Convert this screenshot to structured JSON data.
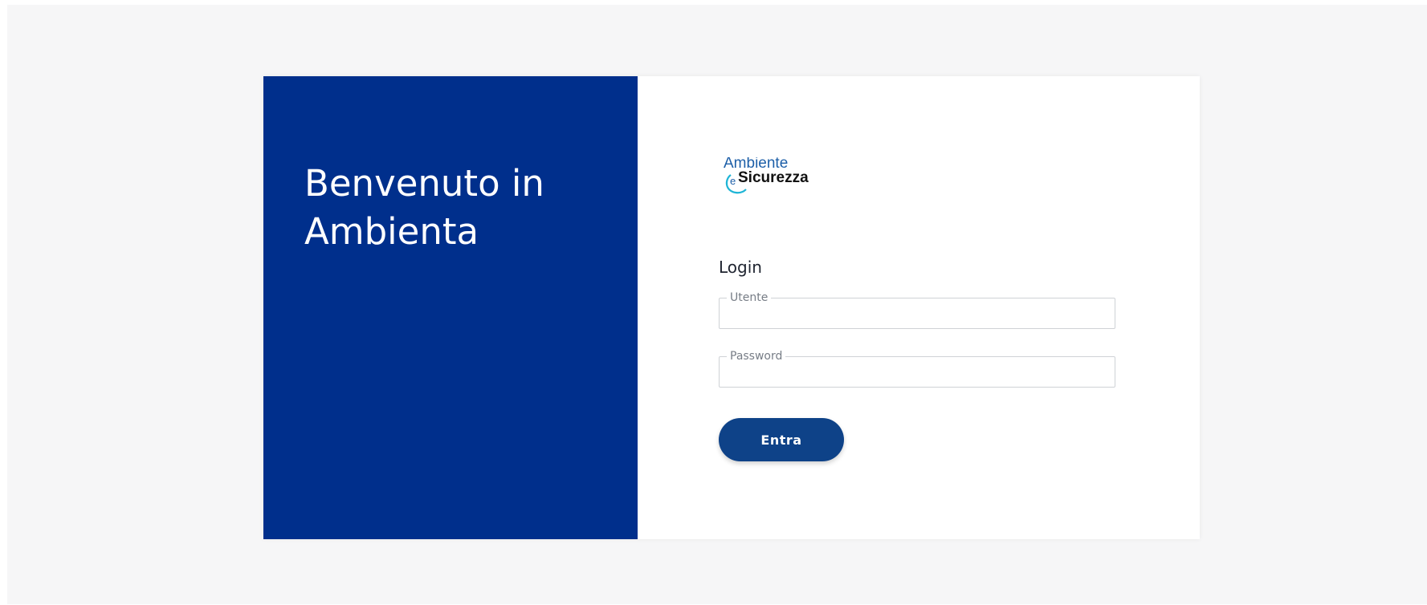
{
  "welcome": {
    "line1": "Benvenuto in",
    "line2": "Ambienta"
  },
  "logo": {
    "text_top": "Ambiente",
    "text_e": "e",
    "text_bottom": "Sicurezza",
    "icon": "ambiente-sicurezza-logo"
  },
  "login": {
    "title": "Login",
    "username": {
      "label": "Utente",
      "value": ""
    },
    "password": {
      "label": "Password",
      "value": ""
    },
    "submit_label": "Entra"
  },
  "colors": {
    "left_panel": "#002f8c",
    "button": "#0e4288",
    "page_background": "#f6f6f7",
    "logo_blue": "#1d5fa8",
    "logo_cyan": "#1fb5d6"
  }
}
